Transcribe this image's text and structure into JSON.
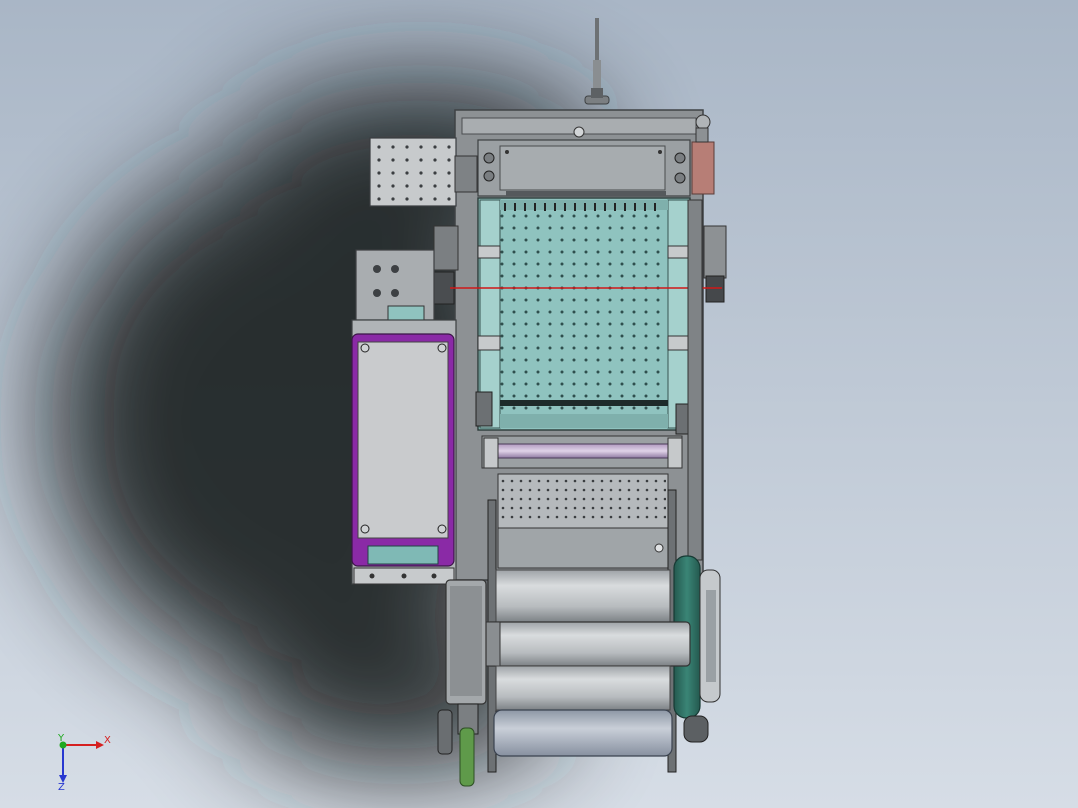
{
  "viewport": {
    "background_top": "#a9b6c6",
    "background_bottom": "#d6dde6",
    "shadow_color": "#1e2124"
  },
  "model": {
    "frame_color": "#8d9194",
    "frame_dark": "#55595c",
    "plate_color": "#9aa3a6",
    "teal_plate": "#8fc3bf",
    "purple_accent": "#8a2aa6",
    "green_wheel": "#2e6f64",
    "roller_color": "#b8bcbf",
    "laser_color": "#d01818",
    "copper_block": "#b77e76",
    "green_tube": "#5f9a4a"
  },
  "triad": {
    "x_label": "X",
    "y_label": "Y",
    "z_label": "Z",
    "x_color": "#d52020",
    "y_color": "#1fa81f",
    "z_color": "#2838d0"
  }
}
